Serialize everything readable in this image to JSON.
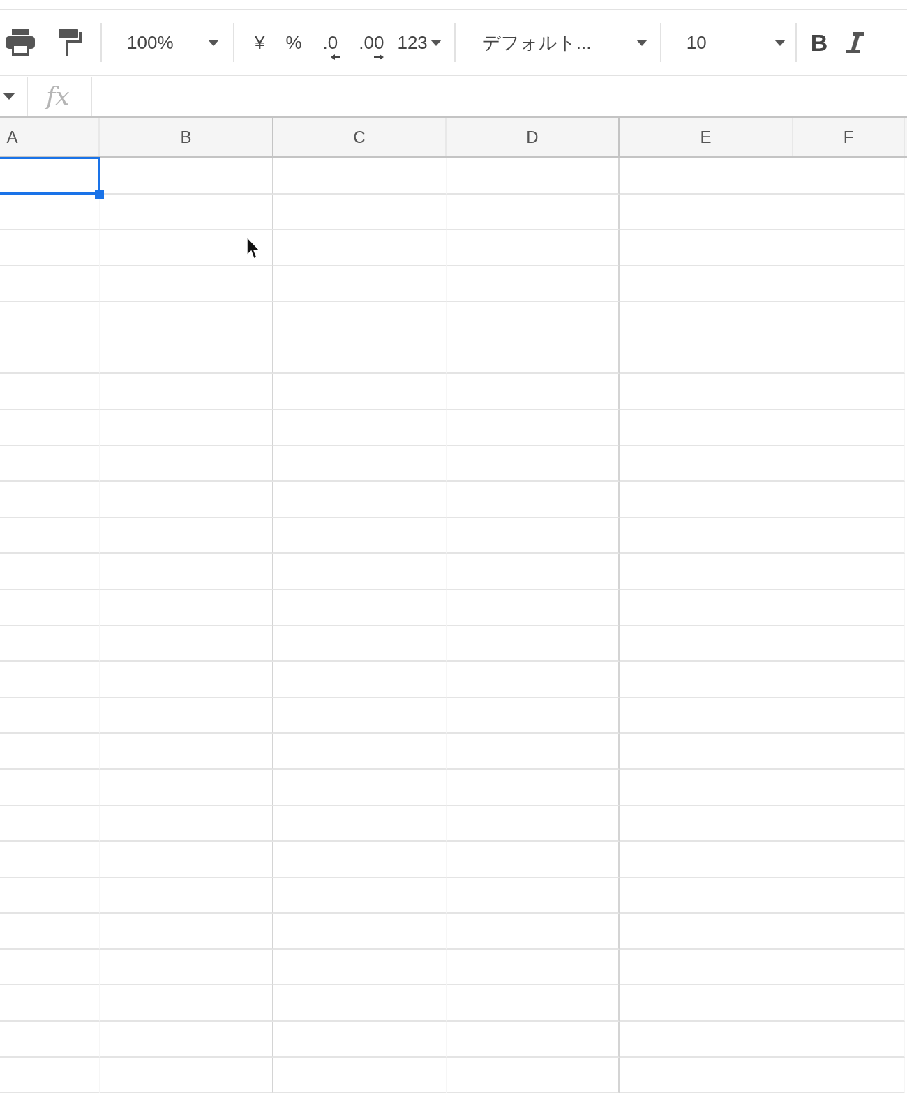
{
  "toolbar": {
    "zoom": "100%",
    "format_buttons": [
      {
        "label": "¥",
        "kind": "plain"
      },
      {
        "label": "%",
        "kind": "plain"
      },
      {
        "label": ".0",
        "kind": "decrease"
      },
      {
        "label": ".00",
        "kind": "increase"
      }
    ],
    "number_format": "123",
    "font": "デフォルト...",
    "font_size": "10",
    "bold": "B"
  },
  "formula_bar": {
    "fx": "fx"
  },
  "columns": [
    {
      "label": "A",
      "selected": true
    },
    {
      "label": "B",
      "selected": false
    },
    {
      "label": "C",
      "selected": false
    },
    {
      "label": "D",
      "selected": false
    },
    {
      "label": "E",
      "selected": false
    },
    {
      "label": "F",
      "selected": false
    }
  ],
  "rows": [
    {
      "kind": "single",
      "selected": true
    },
    {
      "kind": "single",
      "selected": false
    },
    {
      "kind": "single",
      "selected": false
    },
    {
      "kind": "single",
      "selected": false
    },
    {
      "kind": "double",
      "selected": false
    },
    {
      "kind": "single",
      "selected": false
    },
    {
      "kind": "single",
      "selected": false
    },
    {
      "kind": "single",
      "selected": false
    },
    {
      "kind": "single",
      "selected": false
    },
    {
      "kind": "single",
      "selected": false
    },
    {
      "kind": "single",
      "selected": false
    },
    {
      "kind": "single",
      "selected": false
    },
    {
      "kind": "single",
      "selected": false
    },
    {
      "kind": "single",
      "selected": false
    },
    {
      "kind": "single",
      "selected": false
    },
    {
      "kind": "single",
      "selected": false
    },
    {
      "kind": "single",
      "selected": false
    },
    {
      "kind": "single",
      "selected": false
    },
    {
      "kind": "single",
      "selected": false
    },
    {
      "kind": "single",
      "selected": false
    },
    {
      "kind": "single",
      "selected": false
    },
    {
      "kind": "single",
      "selected": false
    },
    {
      "kind": "single",
      "selected": false
    },
    {
      "kind": "single",
      "selected": false
    },
    {
      "kind": "single",
      "selected": false
    }
  ]
}
